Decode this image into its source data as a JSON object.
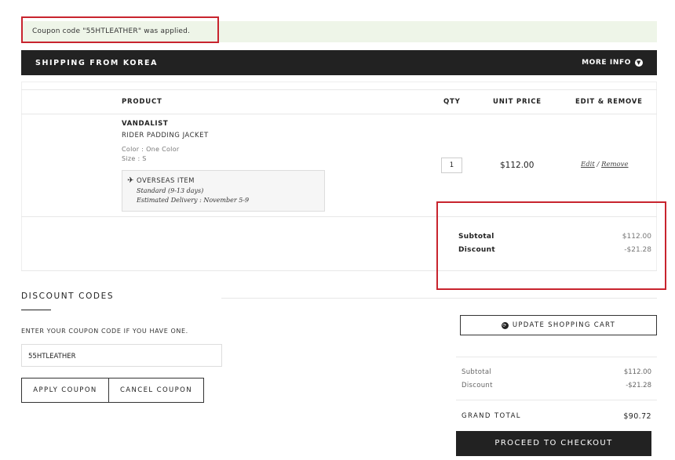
{
  "notice": {
    "message": "Coupon code \"55HTLEATHER\" was applied."
  },
  "shipping": {
    "title": "SHIPPING FROM KOREA",
    "more_info": "MORE INFO",
    "more_icon": "chevron-down-icon"
  },
  "table": {
    "headers": {
      "product": "PRODUCT",
      "qty": "QTY",
      "unit_price": "UNIT PRICE",
      "edit_remove": "EDIT & REMOVE"
    }
  },
  "item": {
    "brand": "VANDALIST",
    "name": "RIDER PADDING JACKET",
    "color": "Color : One Color",
    "size": "Size : S",
    "overseas": {
      "title": "OVERSEAS ITEM",
      "shipping": "Standard (9-13 days)",
      "delivery": "Estimated Delivery : November 5-9",
      "icon": "airplane-icon"
    },
    "qty": "1",
    "price": "$112.00",
    "edit": "Edit",
    "separator": "/",
    "remove": "Remove"
  },
  "item_summary": {
    "subtotal_label": "Subtotal",
    "subtotal": "$112.00",
    "discount_label": "Discount",
    "discount": "-$21.28"
  },
  "discount_codes": {
    "title": "DISCOUNT CODES",
    "hint": "ENTER YOUR COUPON CODE IF YOU HAVE ONE.",
    "code": "55HTLEATHER",
    "apply": "APPLY COUPON",
    "cancel": "CANCEL COUPON"
  },
  "cart": {
    "update": "UPDATE SHOPPING CART",
    "subtotal_label": "Subtotal",
    "subtotal": "$112.00",
    "discount_label": "Discount",
    "discount": "-$21.28",
    "grand_total_label": "GRAND TOTAL",
    "grand_total": "$90.72",
    "checkout": "PROCEED TO CHECKOUT"
  },
  "colors": {
    "highlight": "#c8242e",
    "dark": "#222222",
    "notice_bg": "#eef5e8"
  }
}
